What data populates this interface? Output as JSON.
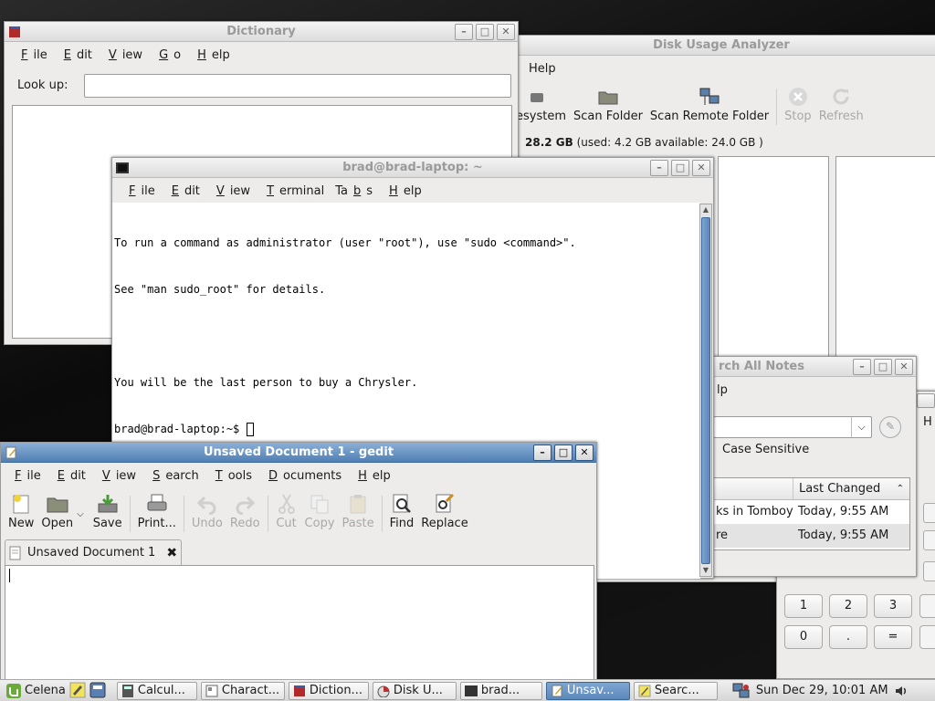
{
  "dictionary": {
    "title": "Dictionary",
    "menu": [
      "File",
      "Edit",
      "View",
      "Go",
      "Help"
    ],
    "lookup_label": "Look up:",
    "lookup_value": ""
  },
  "disk_usage": {
    "title": "Disk Usage Analyzer",
    "menu_help": "Help",
    "tools": {
      "filesystem": "esystem",
      "scan_folder": "Scan Folder",
      "scan_remote": "Scan Remote Folder",
      "stop": "Stop",
      "refresh": "Refresh"
    },
    "fs_size": "28.2 GB",
    "fs_info": " (used: 4.2 GB available: 24.0 GB )"
  },
  "terminal": {
    "title": "brad@brad-laptop: ~",
    "menu": [
      "File",
      "Edit",
      "View",
      "Terminal",
      "Tabs",
      "Help"
    ],
    "lines": [
      "To run a command as administrator (user \"root\"), use \"sudo <command>\".",
      "See \"man sudo_root\" for details.",
      "",
      "You will be the last person to buy a Chrysler.",
      "brad@brad-laptop:~$ "
    ]
  },
  "tomboy": {
    "title": "rch All Notes",
    "menu_help": "lp",
    "case_sensitive": "Case Sensitive",
    "col_changed": "Last Changed",
    "rows": [
      {
        "note": "ks in Tomboy",
        "changed": "Today, 9:55 AM"
      },
      {
        "note": "re",
        "changed": "Today, 9:55 AM"
      }
    ]
  },
  "calculator": {
    "menu_h": "H",
    "keys": [
      "1",
      "2",
      "3",
      "0",
      ".",
      "="
    ]
  },
  "gedit": {
    "title": "Unsaved Document 1 - gedit",
    "menu": [
      "File",
      "Edit",
      "View",
      "Search",
      "Tools",
      "Documents",
      "Help"
    ],
    "tools": {
      "new": "New",
      "open": "Open",
      "save": "Save",
      "print": "Print...",
      "undo": "Undo",
      "redo": "Redo",
      "cut": "Cut",
      "copy": "Copy",
      "paste": "Paste",
      "find": "Find",
      "replace": "Replace"
    },
    "tab_label": "Unsaved Document 1"
  },
  "panel": {
    "menu_label": "Celena",
    "tasks": [
      "Calcul...",
      "Charact...",
      "Diction...",
      "Disk U...",
      "brad...",
      "Unsav...",
      "Searc..."
    ],
    "clock": "Sun Dec 29, 10:01 AM"
  },
  "colors": {
    "accent": "#5a87bb",
    "terminal_bg": "#ffffff"
  }
}
